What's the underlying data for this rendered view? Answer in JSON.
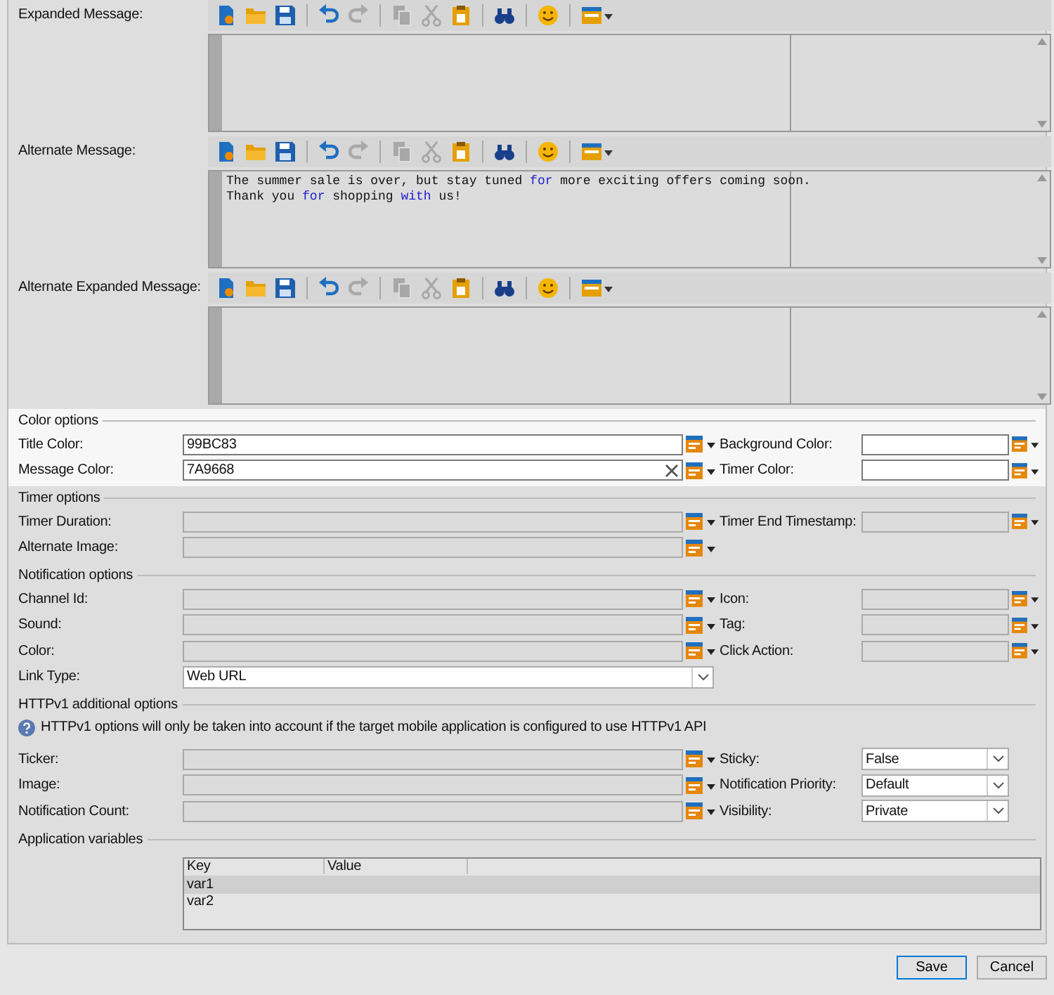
{
  "editors": [
    {
      "label": "Expanded Message:",
      "tools": [
        {
          "kind": "new",
          "disabled": false
        },
        {
          "kind": "open",
          "disabled": false
        },
        {
          "kind": "save",
          "disabled": false
        },
        {
          "kind": "separator"
        },
        {
          "kind": "undo",
          "disabled": false
        },
        {
          "kind": "redo",
          "disabled": true
        },
        {
          "kind": "separator"
        },
        {
          "kind": "copy",
          "disabled": true
        },
        {
          "kind": "cut",
          "disabled": true
        },
        {
          "kind": "paste",
          "disabled": false
        },
        {
          "kind": "separator"
        },
        {
          "kind": "find",
          "disabled": false
        },
        {
          "kind": "separator"
        },
        {
          "kind": "emoji",
          "disabled": false
        },
        {
          "kind": "separator"
        },
        {
          "kind": "insert",
          "disabled": false
        }
      ]
    },
    {
      "label": "Alternate Message:",
      "tools": [
        {
          "kind": "new",
          "disabled": false
        },
        {
          "kind": "open",
          "disabled": false
        },
        {
          "kind": "save",
          "disabled": false
        },
        {
          "kind": "separator"
        },
        {
          "kind": "undo",
          "disabled": false
        },
        {
          "kind": "redo",
          "disabled": true
        },
        {
          "kind": "separator"
        },
        {
          "kind": "copy",
          "disabled": true
        },
        {
          "kind": "cut",
          "disabled": true
        },
        {
          "kind": "paste",
          "disabled": false
        },
        {
          "kind": "separator"
        },
        {
          "kind": "find",
          "disabled": false
        },
        {
          "kind": "separator"
        },
        {
          "kind": "emoji",
          "disabled": false
        },
        {
          "kind": "separator"
        },
        {
          "kind": "insert",
          "disabled": false
        }
      ],
      "lines": [
        [
          {
            "text": "The summer sale is over, but stay tuned ",
            "keyword": false
          },
          {
            "text": "for",
            "keyword": true
          },
          {
            "text": " more exciting offers coming soon.",
            "keyword": false
          }
        ],
        [
          {
            "text": "Thank you ",
            "keyword": false
          },
          {
            "text": "for",
            "keyword": true
          },
          {
            "text": " shopping ",
            "keyword": false
          },
          {
            "text": "with",
            "keyword": true
          },
          {
            "text": " us!",
            "keyword": false
          }
        ]
      ]
    },
    {
      "label": "Alternate Expanded Message:",
      "tools": [
        {
          "kind": "new",
          "disabled": false
        },
        {
          "kind": "open",
          "disabled": false
        },
        {
          "kind": "save",
          "disabled": false
        },
        {
          "kind": "separator"
        },
        {
          "kind": "undo",
          "disabled": false
        },
        {
          "kind": "redo",
          "disabled": true
        },
        {
          "kind": "separator"
        },
        {
          "kind": "copy",
          "disabled": true
        },
        {
          "kind": "cut",
          "disabled": true
        },
        {
          "kind": "paste",
          "disabled": false
        },
        {
          "kind": "separator"
        },
        {
          "kind": "find",
          "disabled": false
        },
        {
          "kind": "separator"
        },
        {
          "kind": "emoji",
          "disabled": false
        },
        {
          "kind": "separator"
        },
        {
          "kind": "insert",
          "disabled": false
        }
      ]
    }
  ],
  "sections": [
    {
      "title": "Color options",
      "highlighted": true,
      "rows": [
        {
          "left": {
            "label": "Title Color:",
            "kind": "text",
            "value": "99BC83",
            "disabled": false
          },
          "right": {
            "label": "Background Color:",
            "kind": "text",
            "disabled": false
          }
        },
        {
          "left": {
            "label": "Message Color:",
            "kind": "text",
            "value": "7A9668",
            "disabled": false,
            "clear_button": true
          },
          "right": {
            "label": "Timer Color:",
            "kind": "text",
            "disabled": false
          }
        }
      ]
    },
    {
      "title": "Timer options",
      "highlighted": false,
      "rows": [
        {
          "left": {
            "label": "Timer Duration:",
            "kind": "text",
            "disabled": true
          },
          "right": {
            "label": "Timer End Timestamp:",
            "kind": "text",
            "disabled": true
          }
        },
        {
          "left": {
            "label": "Alternate Image:",
            "kind": "text",
            "disabled": true
          }
        }
      ]
    },
    {
      "title": "Notification options",
      "highlighted": false,
      "rows": [
        {
          "left": {
            "label": "Channel Id:",
            "kind": "text",
            "disabled": true
          },
          "right": {
            "label": "Icon:",
            "kind": "text",
            "disabled": true
          }
        },
        {
          "left": {
            "label": "Sound:",
            "kind": "text",
            "disabled": true
          },
          "right": {
            "label": "Tag:",
            "kind": "text",
            "disabled": true
          }
        },
        {
          "left": {
            "label": "Color:",
            "kind": "text",
            "disabled": true
          },
          "right": {
            "label": "Click Action:",
            "kind": "text",
            "disabled": true
          }
        },
        {
          "left": {
            "label": "Link Type:",
            "kind": "wide-select",
            "value": "Web URL",
            "disabled": false
          }
        }
      ]
    },
    {
      "title": "HTTPv1 additional options",
      "highlighted": false,
      "note": "HTTPv1 options will only be taken into account if the target mobile application is configured to use HTTPv1 API",
      "rows": [
        {
          "left": {
            "label": "Ticker:",
            "kind": "text",
            "disabled": true
          },
          "right": {
            "label": "Sticky:",
            "kind": "select",
            "value": "False",
            "disabled": false
          }
        },
        {
          "left": {
            "label": "Image:",
            "kind": "text",
            "disabled": true
          },
          "right": {
            "label": "Notification Priority:",
            "kind": "select",
            "value": "Default",
            "disabled": false
          }
        },
        {
          "left": {
            "label": "Notification Count:",
            "kind": "text",
            "disabled": true
          },
          "right": {
            "label": "Visibility:",
            "kind": "select",
            "value": "Private",
            "disabled": false
          }
        }
      ]
    },
    {
      "title": "Application variables",
      "highlighted": false,
      "table": {
        "columns": [
          "Key",
          "Value"
        ],
        "rows": [
          {
            "cells": [
              "var1"
            ],
            "selected": true
          },
          {
            "cells": [
              "var2"
            ],
            "selected": false
          }
        ]
      }
    }
  ],
  "buttons": [
    {
      "label": "Save",
      "default": true
    },
    {
      "label": "Cancel",
      "default": false
    }
  ]
}
